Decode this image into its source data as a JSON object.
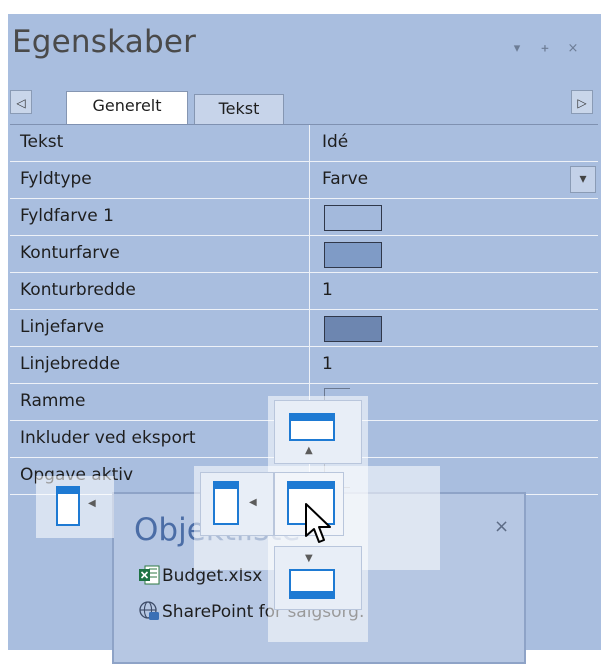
{
  "panel": {
    "title": "Egenskaber",
    "buttons": {
      "dropdown": "▾",
      "pin": "ᚐ",
      "close": "×"
    }
  },
  "tabs": {
    "scroll_left": "◁",
    "scroll_right": "▷",
    "items": [
      {
        "label": "Generelt",
        "active": true
      },
      {
        "label": "Tekst",
        "active": false
      }
    ]
  },
  "properties": [
    {
      "name": "Tekst",
      "value": "Idé",
      "kind": "text"
    },
    {
      "name": "Fyldtype",
      "value": "Farve",
      "kind": "dropdown",
      "dropdown_glyph": "▾"
    },
    {
      "name": "Fyldfarve 1",
      "value": "",
      "kind": "color",
      "color": "#a3b9dc"
    },
    {
      "name": "Konturfarve",
      "value": "",
      "kind": "color",
      "color": "#7f9bc6"
    },
    {
      "name": "Konturbredde",
      "value": "1",
      "kind": "text"
    },
    {
      "name": "Linjefarve",
      "value": "",
      "kind": "color",
      "color": "#6d86b0"
    },
    {
      "name": "Linjebredde",
      "value": "1",
      "kind": "text"
    },
    {
      "name": "Ramme",
      "value": "",
      "kind": "checkbox"
    },
    {
      "name": "Inkluder ved eksport",
      "value": "",
      "kind": "checkbox"
    },
    {
      "name": "Opgave aktiv",
      "value": "",
      "kind": "checkbox"
    }
  ],
  "object_list": {
    "title": "Objektliste",
    "close": "×",
    "items": [
      {
        "label": "Budget.xlsx",
        "icon": "excel-icon"
      },
      {
        "label": "SharePoint for salgsorg.",
        "icon": "sharepoint-globe-icon"
      }
    ]
  },
  "dock_guide": {
    "arrows": {
      "up": "▲",
      "down": "▼",
      "left": "◀"
    }
  },
  "colors": {
    "panel_bg": "#a9bedf",
    "accent": "#1e7ad3",
    "title_text": "#4a4a4a",
    "objectlist_title": "#4b6da6"
  }
}
